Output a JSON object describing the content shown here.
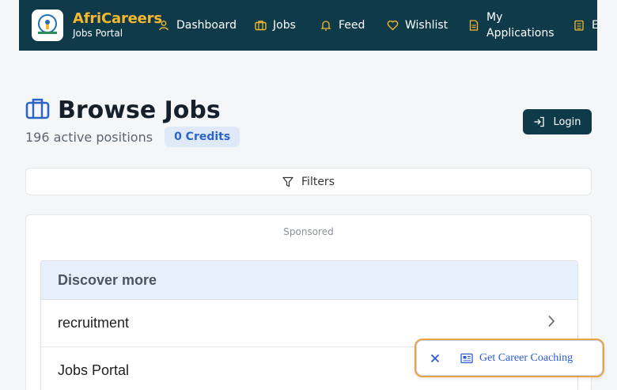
{
  "brand": {
    "name": "AfriCareers",
    "subtitle": "Jobs Portal"
  },
  "nav": [
    {
      "label": "Dashboard",
      "icon": "user-icon"
    },
    {
      "label": "Jobs",
      "icon": "briefcase-icon"
    },
    {
      "label": "Feed",
      "icon": "bell-icon"
    },
    {
      "label": "Wishlist",
      "icon": "heart-icon"
    },
    {
      "label_line1": "My",
      "label_line2": "Applications",
      "icon": "document-icon"
    },
    {
      "label": "E",
      "icon": "building-icon"
    }
  ],
  "header": {
    "title": "Browse Jobs",
    "positions": "196 active positions",
    "credits": "0 Credits",
    "login": "Login"
  },
  "filters": {
    "label": "Filters"
  },
  "ad": {
    "sponsored": "Sponsored",
    "heading": "Discover more",
    "items": [
      "recruitment",
      "Jobs Portal"
    ]
  },
  "coaching": {
    "label": "Get Career Coaching"
  },
  "colors": {
    "nav_bg": "#0f3a4a",
    "brand_accent": "#f5b82e",
    "credits_text": "#2c63c6",
    "discover_bg": "#e8f0fe"
  }
}
